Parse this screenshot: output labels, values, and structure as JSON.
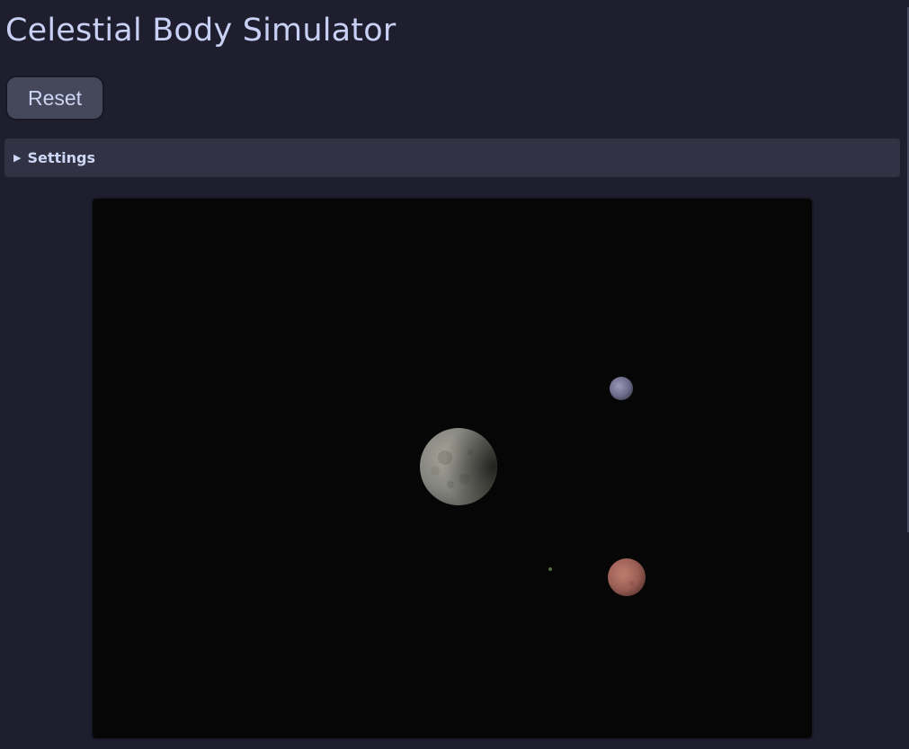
{
  "app": {
    "title": "Celestial Body Simulator"
  },
  "controls": {
    "reset_label": "Reset"
  },
  "settings": {
    "label": "Settings",
    "expanded": false
  },
  "theme": {
    "background": "#1e1e2e",
    "panel": "#313244",
    "button": "#45475a",
    "text": "#cdd6f4",
    "canvas": "#050605"
  },
  "scene": {
    "bodies": [
      {
        "name": "grey-moon",
        "color": "#8a8a80"
      },
      {
        "name": "blue-grey-planet",
        "color": "#7a7a9a"
      },
      {
        "name": "red-planet",
        "color": "#a0605a"
      },
      {
        "name": "green-dot",
        "color": "#4a6a3a"
      }
    ]
  }
}
